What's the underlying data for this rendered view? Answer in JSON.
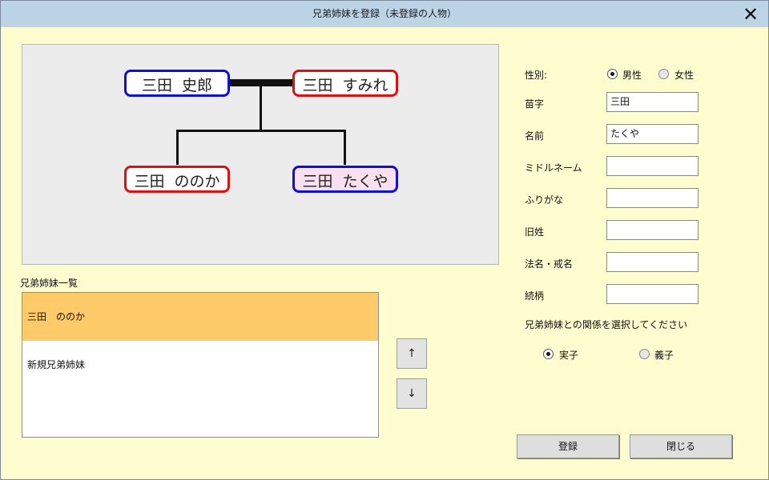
{
  "window": {
    "title": "兄弟姉妹を登録（未登録の人物）"
  },
  "tree": {
    "father": "三田  史郎",
    "mother": "三田  すみれ",
    "child1": "三田  ののか",
    "child2": "三田  たくや",
    "colors": {
      "male": "#1010d0",
      "female": "#dd1111",
      "current_bg": "#f9e0f0"
    }
  },
  "siblings": {
    "label": "兄弟姉妹一覧",
    "items": [
      "三田　ののか",
      "新規兄弟姉妹"
    ],
    "selected_color": "#ffcb6a"
  },
  "order_buttons": {
    "up": "↑",
    "down": "↓"
  },
  "form": {
    "gender": {
      "label": "性別:",
      "male": "男性",
      "female": "女性",
      "selected": "male"
    },
    "surname": {
      "label": "苗字",
      "value": "三田"
    },
    "given_name": {
      "label": "名前",
      "value": "たくや"
    },
    "middle_name": {
      "label": "ミドルネーム",
      "value": ""
    },
    "furigana": {
      "label": "ふりがな",
      "value": ""
    },
    "maiden_name": {
      "label": "旧姓",
      "value": ""
    },
    "buddhist_name": {
      "label": "法名・戒名",
      "value": ""
    },
    "relation": {
      "label": "続柄",
      "value": ""
    },
    "sibling_relation": {
      "prompt": "兄弟姉妹との関係を選択してください",
      "biological": "実子",
      "adopted": "義子",
      "selected": "biological"
    }
  },
  "buttons": {
    "register": "登録",
    "close": "閉じる"
  }
}
